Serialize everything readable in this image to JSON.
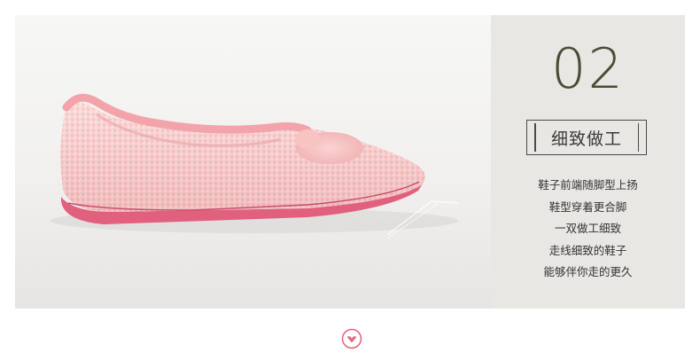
{
  "section": {
    "number": "02",
    "title": "细致做工",
    "lines": [
      "鞋子前端随脚型上扬",
      "鞋型穿着更合脚",
      "一双做工细致",
      "走线细致的鞋子",
      "能够伴你走的更久"
    ]
  },
  "icons": {
    "scroll_down": "chevron-down-circle-icon"
  },
  "colors": {
    "number": "#4e4a36",
    "panel": "#e8e7e4",
    "accent_pink": "#e0607e"
  }
}
